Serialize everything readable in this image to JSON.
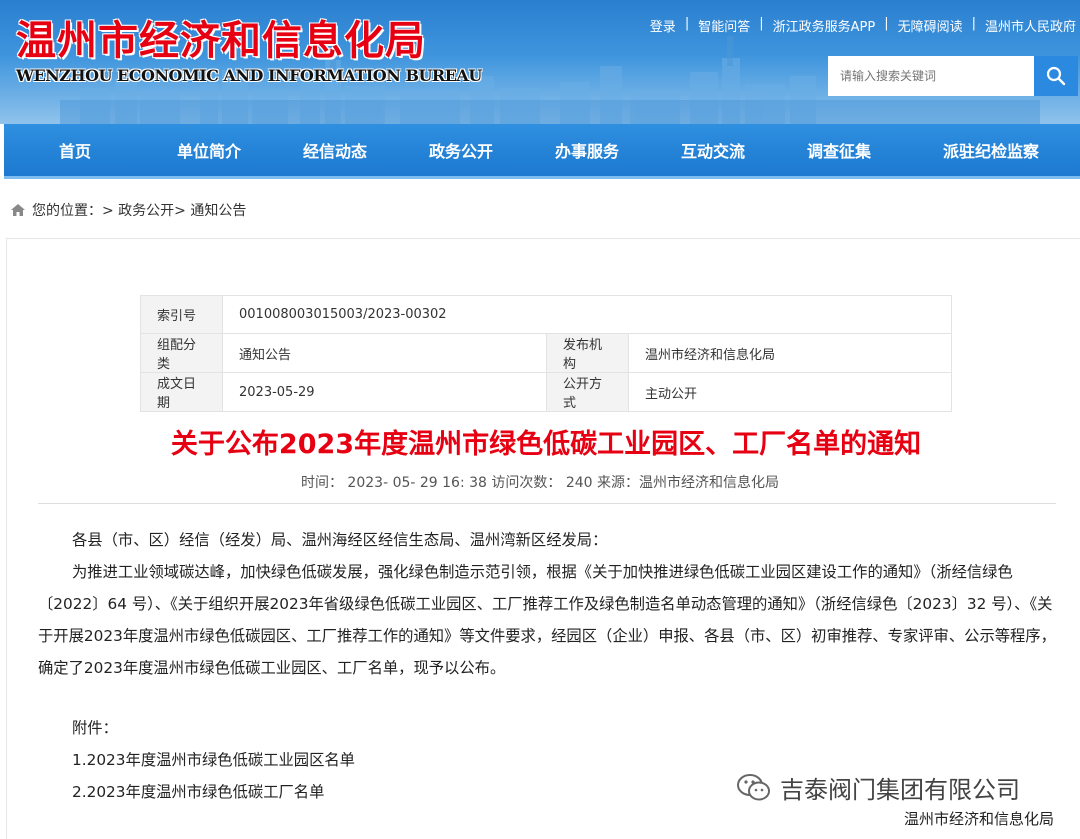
{
  "header": {
    "title": "温州市经济和信息化局",
    "subtitle": "WENZHOU ECONOMIC AND INFORMATION BUREAU",
    "top_links": [
      "登录",
      "智能问答",
      "浙江政务服务APP",
      "无障碍阅读",
      "温州市人民政府"
    ],
    "search": {
      "placeholder": "请输入搜索关键词"
    }
  },
  "nav": {
    "items": [
      "首页",
      "单位简介",
      "经信动态",
      "政务公开",
      "办事服务",
      "互动交流",
      "调查征集",
      "派驻纪检监察"
    ]
  },
  "breadcrumb": {
    "prefix": "您的位置：",
    "path": "> 政务公开> 通知公告"
  },
  "meta_table": {
    "index_label": "索引号",
    "index_value": "001008003015003/2023-00302",
    "category_label": "组配分类",
    "category_value": "通知公告",
    "publisher_label": "发布机构",
    "publisher_value": "温州市经济和信息化局",
    "date_label": "成文日期",
    "date_value": "2023-05-29",
    "disclosure_label": "公开方式",
    "disclosure_value": "主动公开"
  },
  "article": {
    "title": "关于公布2023年度温州市绿色低碳工业园区、工厂名单的通知",
    "meta": "时间：  2023- 05- 29 16: 38 访问次数：  240    来源：温州市经济和信息化局",
    "salutation": "各县（市、区）经信（经发）局、温州海经区经信生态局、温州湾新区经发局：",
    "para_1": "为推进工业领域碳达峰，加快绿色低碳发展，强化绿色制造示范引领，根据《关于加快推进绿色低碳工业园区建设工作的通知》（浙经信绿色〔2022〕64 号）、《关于组织开展2023年省级绿色低碳工业园区、工厂推荐工作及绿色制造名单动态管理的通知》（浙经信绿色〔2023〕32 号）、《关于开展2023年度温州市绿色低碳园区、工厂推荐工作的通知》等文件要求，经园区（企业）申报、各县（市、区）初审推荐、专家评审、公示等程序，确定了2023年度温州市绿色低碳工业园区、工厂名单，现予以公布。",
    "attachments_label": "附件：",
    "attachment_1": "1.2023年度温州市绿色低碳工业园区名单",
    "attachment_2": "2.2023年度温州市绿色低碳工厂名单"
  },
  "watermark": "吉泰阀门集团有限公司",
  "footer_source": "温州市经济和信息化局"
}
